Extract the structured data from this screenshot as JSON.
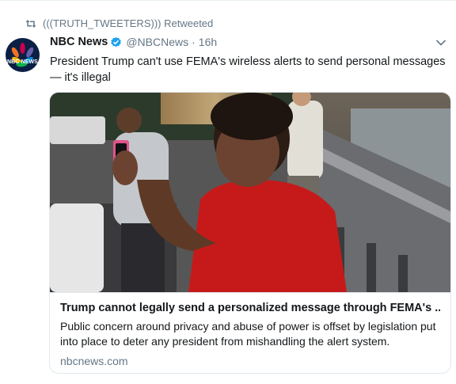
{
  "retweet": {
    "retweeter": "(((TRUTH_TWEETERS)))",
    "label": "Retweeted",
    "icon": "retweet-icon"
  },
  "tweet": {
    "author_name": "NBC News",
    "handle": "@NBCNews",
    "separator": "·",
    "time": "16h",
    "avatar_text": "NBC NEWS",
    "text": "President Trump can't use FEMA's wireless alerts to send personal messages — it's illegal"
  },
  "card": {
    "title": "Trump cannot legally send a personalized message through FEMA's ...",
    "description": "Public concern around privacy and abuse of power is offset by legislation put into place to deter any president from mishandling the alert system.",
    "domain": "nbcnews.com"
  },
  "colors": {
    "secondary_text": "#657786",
    "verified_blue": "#1da1f2",
    "border": "#e1e8ed"
  }
}
